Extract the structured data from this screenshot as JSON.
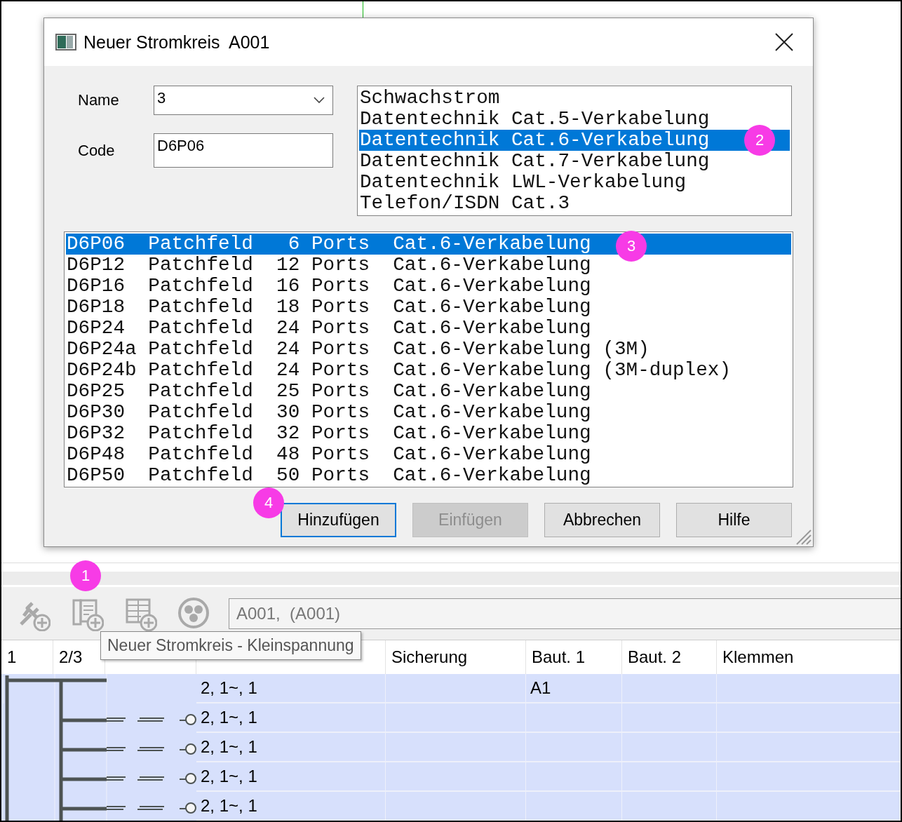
{
  "dialog": {
    "title": "Neuer Stromkreis  A001",
    "fields": [
      {
        "label": "Name",
        "value": "3",
        "kind": "dropdown"
      },
      {
        "label": "Code",
        "value": "D6P06",
        "kind": "text"
      }
    ],
    "category_list": [
      {
        "text": "Schwachstrom",
        "selected": false
      },
      {
        "text": "Datentechnik Cat.5-Verkabelung",
        "selected": false
      },
      {
        "text": "Datentechnik Cat.6-Verkabelung",
        "selected": true,
        "callout": "2"
      },
      {
        "text": "Datentechnik Cat.7-Verkabelung",
        "selected": false
      },
      {
        "text": "Datentechnik LWL-Verkabelung",
        "selected": false
      },
      {
        "text": "Telefon/ISDN Cat.3",
        "selected": false
      }
    ],
    "code_list": [
      {
        "text": "D6P06  Patchfeld   6 Ports  Cat.6-Verkabelung",
        "selected": true,
        "callout": "3"
      },
      {
        "text": "D6P12  Patchfeld  12 Ports  Cat.6-Verkabelung",
        "selected": false
      },
      {
        "text": "D6P16  Patchfeld  16 Ports  Cat.6-Verkabelung",
        "selected": false
      },
      {
        "text": "D6P18  Patchfeld  18 Ports  Cat.6-Verkabelung",
        "selected": false
      },
      {
        "text": "D6P24  Patchfeld  24 Ports  Cat.6-Verkabelung",
        "selected": false
      },
      {
        "text": "D6P24a Patchfeld  24 Ports  Cat.6-Verkabelung (3M)",
        "selected": false
      },
      {
        "text": "D6P24b Patchfeld  24 Ports  Cat.6-Verkabelung (3M-duplex)",
        "selected": false
      },
      {
        "text": "D6P25  Patchfeld  25 Ports  Cat.6-Verkabelung",
        "selected": false
      },
      {
        "text": "D6P30  Patchfeld  30 Ports  Cat.6-Verkabelung",
        "selected": false
      },
      {
        "text": "D6P32  Patchfeld  32 Ports  Cat.6-Verkabelung",
        "selected": false
      },
      {
        "text": "D6P48  Patchfeld  48 Ports  Cat.6-Verkabelung",
        "selected": false
      },
      {
        "text": "D6P50  Patchfeld  50 Ports  Cat.6-Verkabelung",
        "selected": false
      }
    ],
    "buttons": [
      {
        "label": "Hinzufügen",
        "focused": true,
        "disabled": false,
        "callout": "4"
      },
      {
        "label": "Einfügen",
        "focused": false,
        "disabled": true
      },
      {
        "label": "Abbrechen",
        "focused": false,
        "disabled": false
      },
      {
        "label": "Hilfe",
        "focused": false,
        "disabled": false
      }
    ]
  },
  "toolbar": {
    "buttons": [
      {
        "kind": "plug-add",
        "disabled": true
      },
      {
        "kind": "circuit-add",
        "disabled": true,
        "callout": "1"
      },
      {
        "kind": "distribution-add",
        "disabled": true
      },
      {
        "kind": "circle-symbol",
        "disabled": true
      }
    ],
    "path_field": "A001,  (A001)",
    "tooltip": "Neuer Stromkreis - Kleinspannung"
  },
  "table": {
    "columns": [
      {
        "kind": "label",
        "label": "1"
      },
      {
        "kind": "label",
        "label": "2/3"
      },
      {
        "kind": "covered"
      },
      {
        "kind": "covered"
      },
      {
        "kind": "label",
        "label": "Sicherung"
      },
      {
        "kind": "label",
        "label": "Baut. 1"
      },
      {
        "kind": "label",
        "label": "Baut. 2"
      },
      {
        "kind": "label",
        "label": "Klemmen"
      }
    ],
    "rows": [
      {
        "kind": "feeder",
        "column_4": "2, 1~, 1",
        "baut_1": "A1"
      },
      {
        "kind": "branch",
        "column_4": "2, 1~, 1"
      },
      {
        "kind": "branch",
        "column_4": "2, 1~, 1"
      },
      {
        "kind": "branch",
        "column_4": "2, 1~, 1"
      },
      {
        "kind": "branch",
        "column_4": "2, 1~, 1"
      }
    ]
  }
}
